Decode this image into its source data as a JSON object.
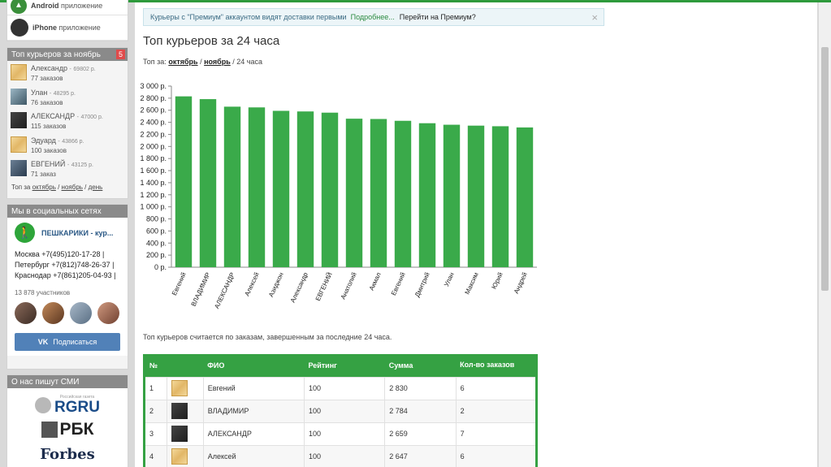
{
  "sidebar": {
    "apps": [
      {
        "bold": "Android",
        "label": "приложение",
        "icon": "android-icon"
      },
      {
        "bold": "iPhone",
        "label": "приложение",
        "icon": "apple-icon"
      }
    ],
    "top_couriers": {
      "title": "Топ курьеров за ноябрь",
      "badge": "5",
      "items": [
        {
          "name": "Александр",
          "sum": "69802 р.",
          "orders": "77 заказов",
          "avatar": "wood"
        },
        {
          "name": "Улан",
          "sum": "48295 р.",
          "orders": "76 заказов",
          "avatar": "photo1"
        },
        {
          "name": "АЛЕКСАНДР",
          "sum": "47000 р.",
          "orders": "115 заказов",
          "avatar": "photo2"
        },
        {
          "name": "Эдуард",
          "sum": "43866 р.",
          "orders": "100 заказов",
          "avatar": "wood"
        },
        {
          "name": "ЕВГЕНИЙ",
          "sum": "43125 р.",
          "orders": "71 заказ",
          "avatar": "photo3"
        }
      ],
      "footer_prefix": "Топ за",
      "footer_links": [
        "октябрь",
        "ноябрь",
        "день"
      ]
    },
    "social": {
      "title": "Мы в социальных сетях",
      "group_name": "ПЕШКАРИКИ - кур...",
      "phones": "Москва +7(495)120-17-28 | Петербург +7(812)748-26-37 | Краснодар +7(861)205-04-93 |",
      "members": "13 878 участников",
      "button": "Подписаться",
      "button_icon": "vk-icon"
    },
    "media": {
      "title": "О нас пишут СМИ",
      "logos": [
        "RGRU",
        "РБК",
        "Forbes"
      ],
      "rg_small": "Российская газета"
    }
  },
  "notice": {
    "text": "Курьеры с \"Премиум\" аккаунтом видят доставки первыми",
    "more": "Подробнее...",
    "premium": "Перейти на Премиум?",
    "close": "×"
  },
  "page": {
    "title": "Топ курьеров за 24 часа",
    "period_prefix": "Топ за:",
    "period_links": [
      "октябрь",
      "ноябрь"
    ],
    "period_current": "24 часа",
    "note": "Топ курьеров считается по заказам, завершенным за последние 24 часа."
  },
  "chart_data": {
    "type": "bar",
    "categories": [
      "Евгений",
      "ВЛАДИМИР",
      "АЛЕКСАНДР",
      "Алексей",
      "Азиджон",
      "Александр",
      "ЕВГЕНИЙ",
      "Анатолий",
      "Акмал",
      "Евгений",
      "Дмитрий",
      "Улан",
      "Максим",
      "Юрий",
      "Андрей"
    ],
    "values": [
      2830,
      2784,
      2659,
      2647,
      2590,
      2580,
      2560,
      2460,
      2455,
      2425,
      2385,
      2360,
      2345,
      2335,
      2315
    ],
    "yticks": [
      "0 р.",
      "200 р.",
      "400 р.",
      "600 р.",
      "800 р.",
      "1 000 р.",
      "1 200 р.",
      "1 400 р.",
      "1 600 р.",
      "1 800 р.",
      "2 000 р.",
      "2 200 р.",
      "2 400 р.",
      "2 600 р.",
      "2 800 р.",
      "3 000 р."
    ],
    "ylim": [
      0,
      3000
    ],
    "color": "#3aaa4a"
  },
  "table": {
    "headers": [
      "№",
      "",
      "ФИО",
      "Рейтинг",
      "Сумма",
      "Кол-во заказов"
    ],
    "rows": [
      {
        "num": "1",
        "avatar": "wood",
        "name": "Евгений",
        "rating": "100",
        "sum": "2 830",
        "orders": "6"
      },
      {
        "num": "2",
        "avatar": "photo2",
        "name": "ВЛАДИМИР",
        "rating": "100",
        "sum": "2 784",
        "orders": "2"
      },
      {
        "num": "3",
        "avatar": "photo2",
        "name": "АЛЕКСАНДР",
        "rating": "100",
        "sum": "2 659",
        "orders": "7"
      },
      {
        "num": "4",
        "avatar": "wood",
        "name": "Алексей",
        "rating": "100",
        "sum": "2 647",
        "orders": "6"
      }
    ]
  }
}
